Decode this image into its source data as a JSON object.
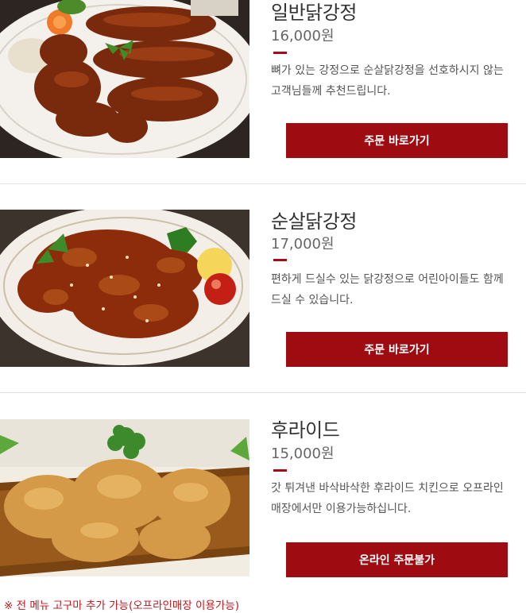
{
  "menu": [
    {
      "name": "일반닭강정",
      "price": "16,000원",
      "description": "뼈가 있는 강정으로 순살닭강정을 선호하시지 않는 고객님들께 추천드립니다.",
      "button": "주문 바로가기",
      "image": "glazed-bone-in-chicken-photo"
    },
    {
      "name": "순살닭강정",
      "price": "17,000원",
      "description": "편하게 드실수 있는 닭강정으로 어린아이들도 함께 드실 수 있습니다.",
      "button": "주문 바로가기",
      "image": "glazed-boneless-chicken-photo"
    },
    {
      "name": "후라이드",
      "price": "15,000원",
      "description": "갓 튀겨낸 바삭바삭한 후라이드 치킨으로 오프라인매장에서만 이용가능하십니다.",
      "button": "온라인 주문불가",
      "image": "fried-chicken-photo"
    }
  ],
  "footnote": "※ 전 메뉴 고구마 추가 가능(오프라인매장 이용가능)",
  "colors": {
    "accent": "#9e0b10",
    "note": "#c4161c"
  }
}
